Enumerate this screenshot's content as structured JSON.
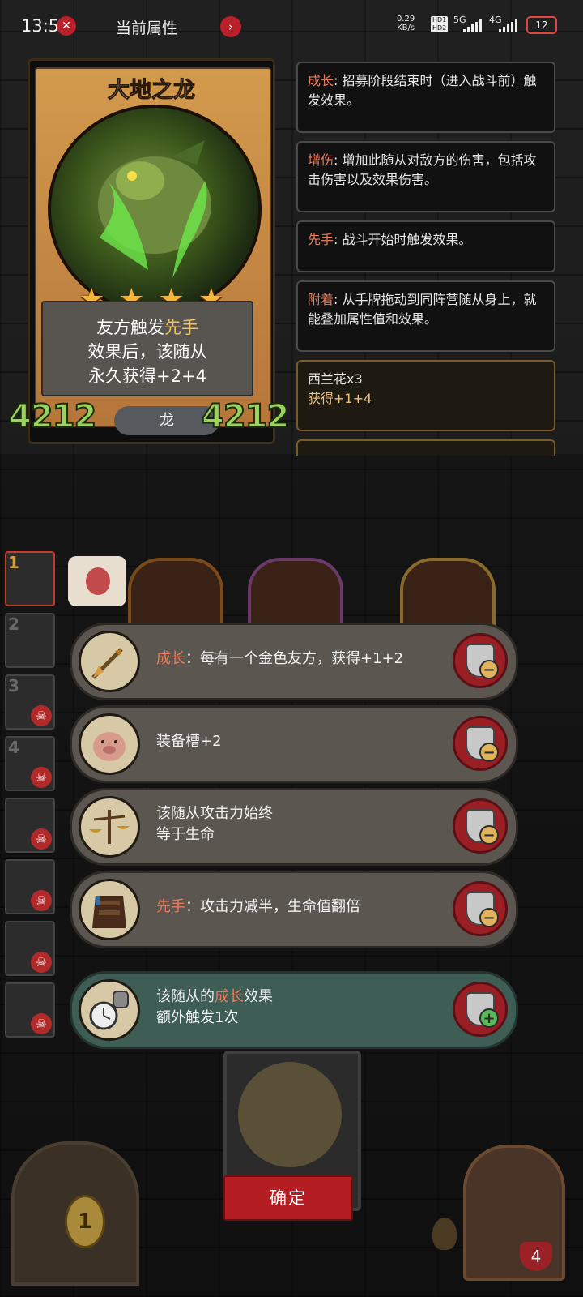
{
  "status_bar": {
    "time": "13:59",
    "title": "当前属性",
    "net_speed_value": "0.29",
    "net_speed_unit": "KB/s",
    "hd1": "HD1",
    "hd2": "HD2",
    "sig1": "5G",
    "sig2": "4G",
    "battery": "12"
  },
  "card": {
    "name": "大地之龙",
    "stars": 4,
    "desc_line1_a": "友方触发",
    "desc_line1_b": "先手",
    "desc_line2": "效果后，该随从",
    "desc_line3": "永久获得+2+4",
    "attack": "4212",
    "health": "4212",
    "tribe": "龙"
  },
  "keywords": [
    {
      "term": "成长",
      "text": ": 招募阶段结束时（进入战斗前）触发效果。"
    },
    {
      "term": "增伤",
      "text": ": 增加此随从对敌方的伤害，包括攻击伤害以及效果伤害。"
    },
    {
      "term": "先手",
      "text": ": 战斗开始时触发效果。"
    },
    {
      "term": "附着",
      "text": ": 从手牌拖动到同阵营随从身上，就能叠加属性值和效果。"
    }
  ],
  "buff_entry": {
    "line1": "西兰花x3",
    "line2": "获得+1+4"
  },
  "party_slots": [
    "1",
    "2",
    "3",
    "4",
    "",
    "",
    "",
    ""
  ],
  "effects": [
    {
      "kw": "成长",
      "text": "：每有一个金色友方，获得+1+2",
      "text2": "",
      "icon": "arrow-icon",
      "action": "−",
      "active": false
    },
    {
      "kw": "",
      "text": "装备槽+2",
      "text2": "",
      "icon": "pig-icon",
      "action": "−",
      "active": false
    },
    {
      "kw": "",
      "text": "该随从攻击力始终",
      "text2": "等于生命",
      "icon": "scales-icon",
      "action": "−",
      "active": false
    },
    {
      "kw": "先手",
      "text": "：攻击力减半，生命值翻倍",
      "text2": "",
      "icon": "armor-icon",
      "action": "−",
      "active": false
    },
    {
      "kw_pre": "该随从的",
      "kw": "成长",
      "text": "效果",
      "text2": "额外触发1次",
      "icon": "stopwatch-fist-icon",
      "action": "+",
      "active": true
    }
  ],
  "bottom": {
    "confirm": "确定",
    "coins": "1",
    "hero_hp": "4"
  },
  "colors": {
    "keyword": "#e87b59",
    "gold_text": "#f3c15a",
    "stat_green": "#9ad35c",
    "confirm_red": "#b41e22",
    "active_row": "#3e5e55"
  }
}
